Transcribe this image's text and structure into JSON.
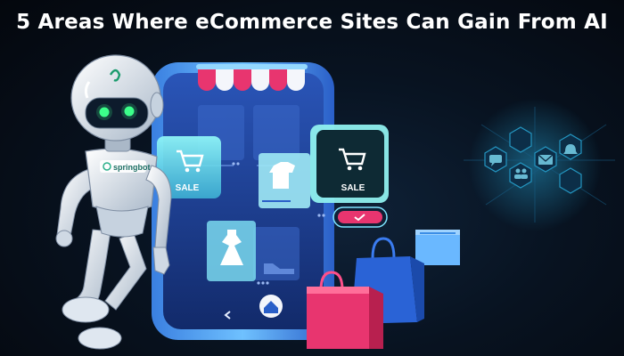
{
  "headline": "5 Areas Where eCommerce Sites Can Gain From AI",
  "robot": {
    "brand": "springbot"
  },
  "phone": {
    "sale_label_1": "SALE",
    "sale_label_2": "SALE"
  },
  "colors": {
    "background": "#05080f",
    "phone_screen": "#1c3f8f",
    "card_glow": "#6fe9f2",
    "accent_pink": "#e8356f",
    "bag_blue": "#2a63d6",
    "robot_eyes": "#3dff8a"
  },
  "icons": [
    "cart-icon",
    "shirt-icon",
    "dress-icon",
    "shoe-icon",
    "home-icon",
    "back-arrow-icon",
    "check-icon",
    "chat-icon",
    "email-icon",
    "users-icon",
    "shopping-bag-icon"
  ]
}
